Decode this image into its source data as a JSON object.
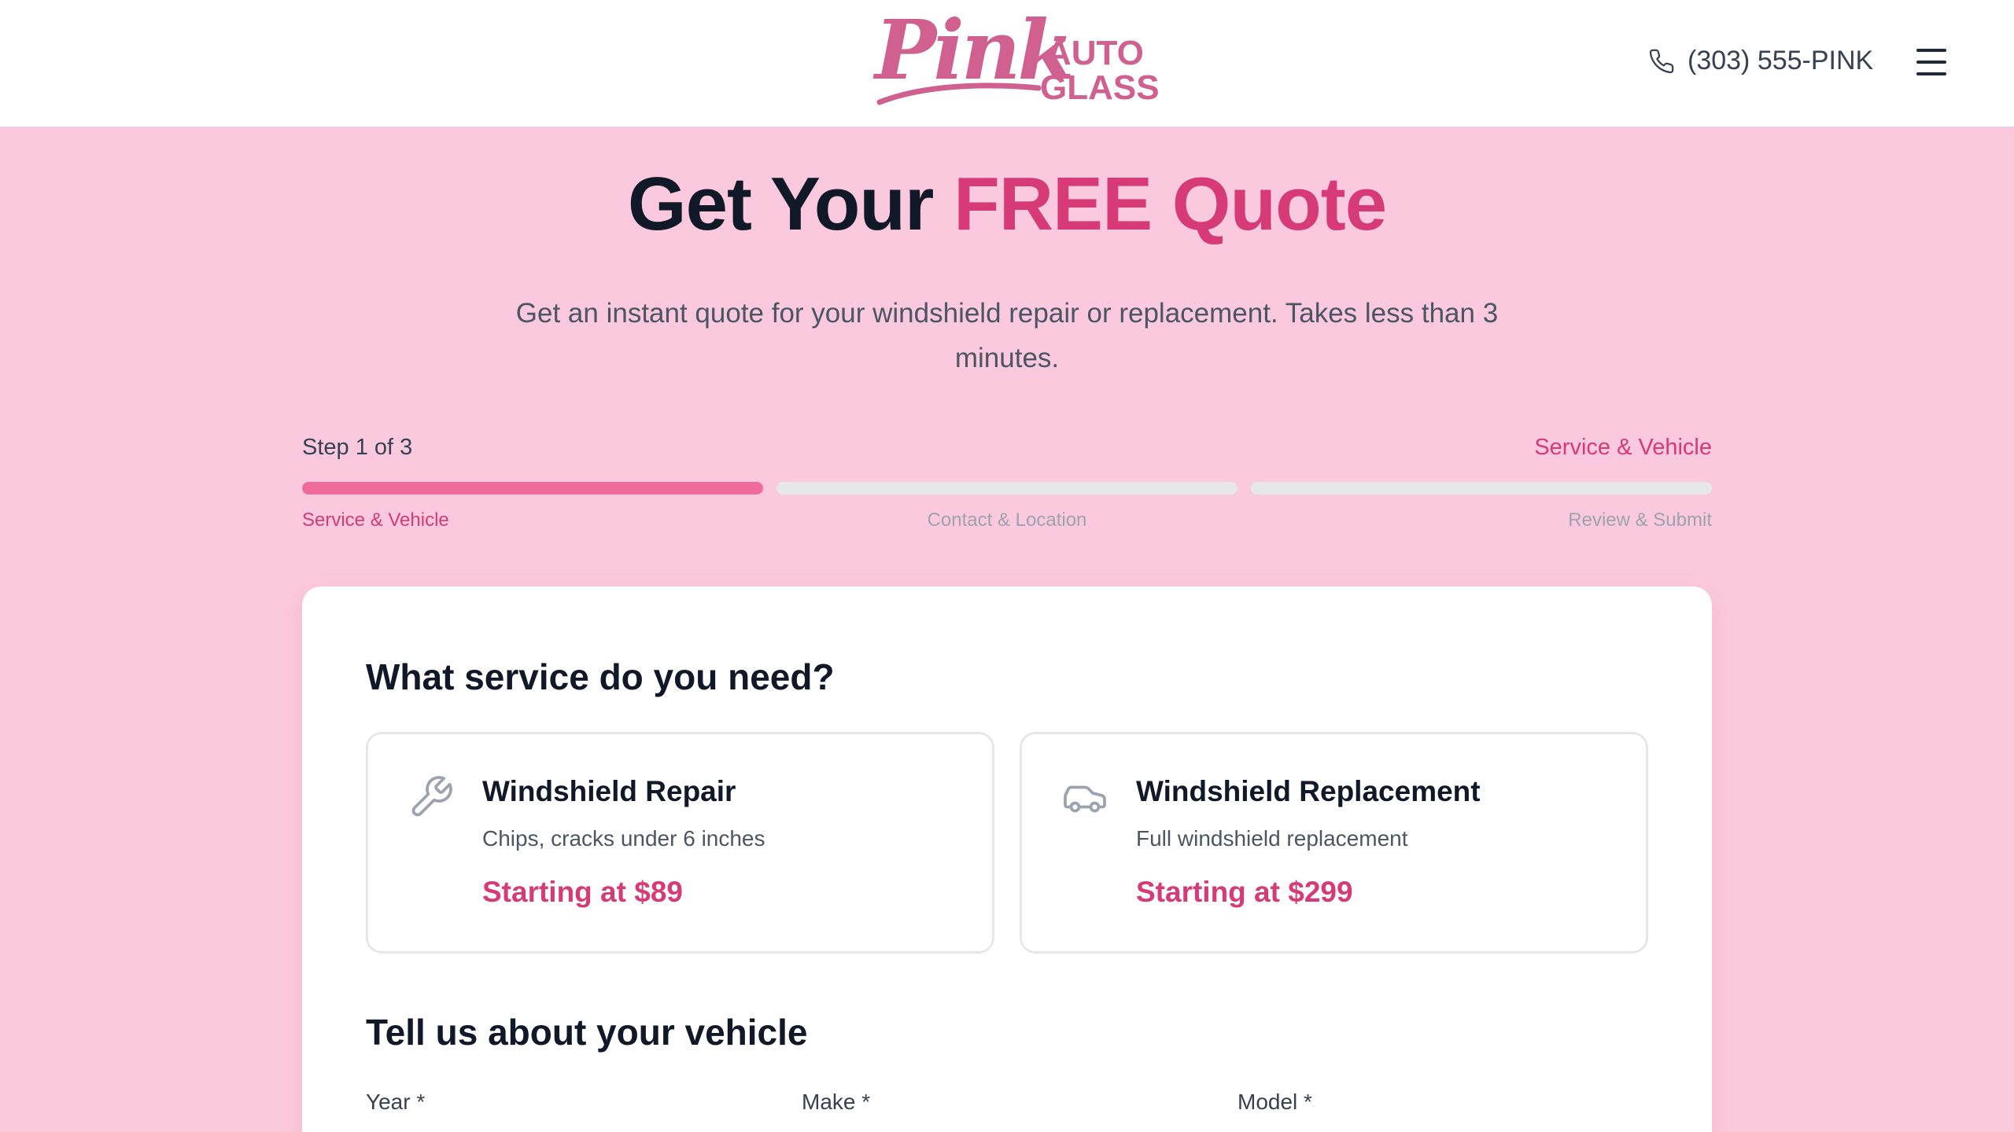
{
  "brand": {
    "logo_script": "Pink",
    "logo_word_1": "AUTO",
    "logo_word_2": "GLASS",
    "accent_color": "#d63b77",
    "logo_color": "#d0608f"
  },
  "header": {
    "phone_icon": "phone-icon",
    "phone": "(303) 555-PINK",
    "menu_icon": "hamburger-menu-icon"
  },
  "hero": {
    "title_prefix": "Get Your ",
    "title_accent": "FREE Quote",
    "subtitle": "Get an instant quote for your windshield repair or replacement. Takes less than 3 minutes."
  },
  "progress": {
    "step_text": "Step 1 of 3",
    "current_label": "Service & Vehicle",
    "current_step": 1,
    "total_steps": 3,
    "steps": [
      {
        "label": "Service & Vehicle",
        "active": true
      },
      {
        "label": "Contact & Location",
        "active": false
      },
      {
        "label": "Review & Submit",
        "active": false
      }
    ]
  },
  "form": {
    "service_heading": "What service do you need?",
    "services": [
      {
        "icon": "wrench-icon",
        "title": "Windshield Repair",
        "description": "Chips, cracks under 6 inches",
        "price": "Starting at $89"
      },
      {
        "icon": "car-icon",
        "title": "Windshield Replacement",
        "description": "Full windshield replacement",
        "price": "Starting at $299"
      }
    ],
    "vehicle_heading": "Tell us about your vehicle",
    "fields": {
      "year_label": "Year *",
      "make_label": "Make *",
      "model_label": "Model *"
    }
  }
}
